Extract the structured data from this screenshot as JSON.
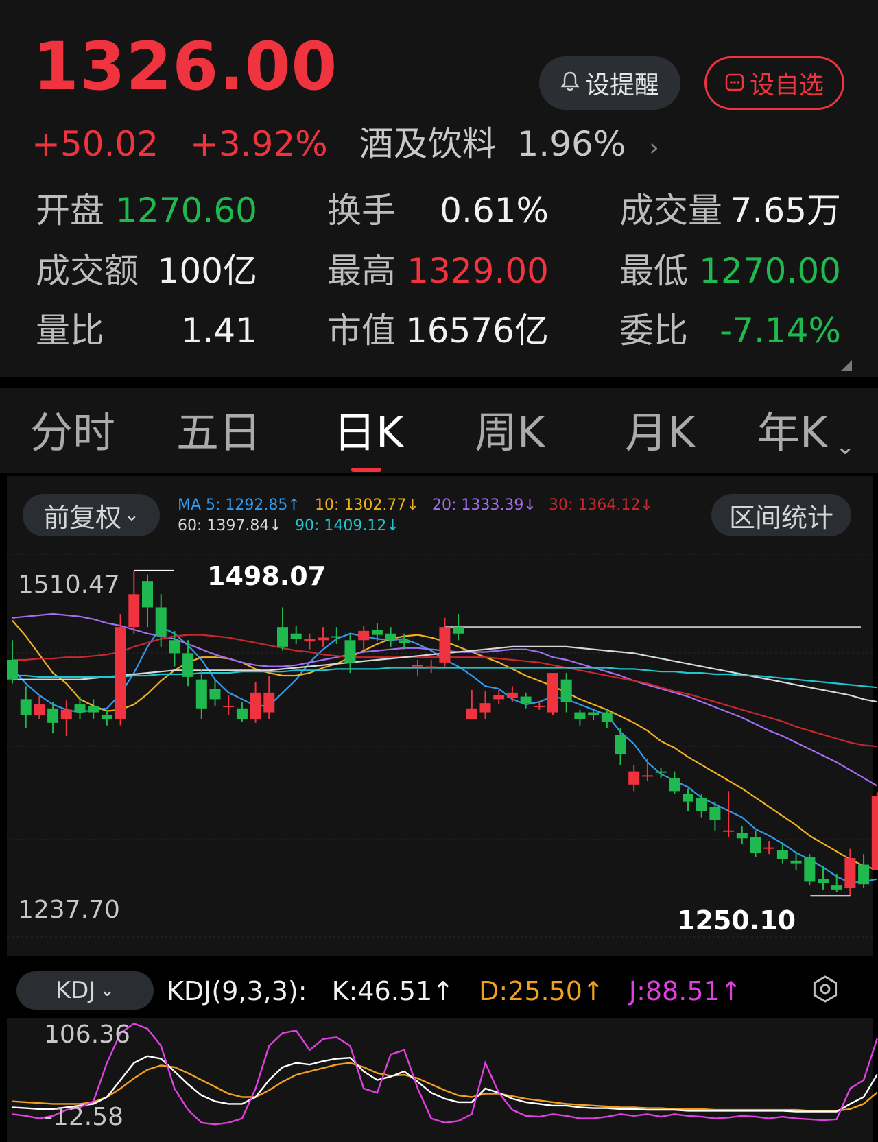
{
  "quote": {
    "price": "1326.00",
    "change": "+50.02",
    "change_pct": "+3.92%",
    "sector_name": "酒及饮料",
    "sector_change": "1.96%",
    "sector_arrow": "›",
    "alert_label": "设提醒",
    "watch_label": "设自选",
    "colors": {
      "up": "#f0343f",
      "down": "#1fb94f"
    }
  },
  "stats": [
    {
      "label": "开盘",
      "value": "1270.60",
      "color": "green"
    },
    {
      "label": "换手",
      "value": "0.61%",
      "color": "white"
    },
    {
      "label": "成交量",
      "value": "7.65万",
      "color": "white"
    },
    {
      "label": "成交额",
      "value": "100亿",
      "color": "white"
    },
    {
      "label": "最高",
      "value": "1329.00",
      "color": "red"
    },
    {
      "label": "最低",
      "value": "1270.00",
      "color": "green"
    },
    {
      "label": "量比",
      "value": "1.41",
      "color": "white"
    },
    {
      "label": "市值",
      "value": "16576亿",
      "color": "white"
    },
    {
      "label": "委比",
      "value": "-7.14%",
      "color": "green"
    }
  ],
  "tabs": [
    {
      "label": "分时",
      "active": false
    },
    {
      "label": "五日",
      "active": false
    },
    {
      "label": "日K",
      "active": true
    },
    {
      "label": "周K",
      "active": false
    },
    {
      "label": "月K",
      "active": false
    },
    {
      "label": "年K",
      "active": false
    }
  ],
  "tab_more": "⌄",
  "chart_controls": {
    "adjust_label": "前复权",
    "range_label": "区间统计",
    "dropdown": "⌄"
  },
  "ma_legend": [
    {
      "text": "MA 5: 1292.85↑",
      "color": "#2f9bf0"
    },
    {
      "text": "10: 1302.77↓",
      "color": "#f2b01e"
    },
    {
      "text": "20: 1333.39↓",
      "color": "#a46ef2"
    },
    {
      "text": "30: 1364.12↓",
      "color": "#c9262d"
    },
    {
      "text": "60: 1397.84↓",
      "color": "#d9d9d9"
    },
    {
      "text": "90: 1409.12↓",
      "color": "#1ec6cf"
    }
  ],
  "chart_data": {
    "type": "candlestick",
    "ymax_label": "1510.47",
    "ymin_label": "1237.70",
    "ylim": [
      1237.7,
      1510.47
    ],
    "high_mark": "1498.07",
    "low_mark": "1250.10",
    "ref_line": 1455,
    "candles": [
      [
        1430,
        1415,
        1445,
        1412
      ],
      [
        1400,
        1388,
        1410,
        1378
      ],
      [
        1388,
        1396,
        1403,
        1385
      ],
      [
        1393,
        1382,
        1398,
        1374
      ],
      [
        1385,
        1392,
        1399,
        1372
      ],
      [
        1396,
        1390,
        1402,
        1385
      ],
      [
        1395,
        1390,
        1400,
        1385
      ],
      [
        1388,
        1385,
        1392,
        1380
      ],
      [
        1385,
        1455,
        1465,
        1380
      ],
      [
        1455,
        1480,
        1498,
        1450
      ],
      [
        1490,
        1470,
        1495,
        1455
      ],
      [
        1470,
        1448,
        1480,
        1440
      ],
      [
        1445,
        1435,
        1452,
        1425
      ],
      [
        1435,
        1417,
        1445,
        1410
      ],
      [
        1415,
        1393,
        1423,
        1385
      ],
      [
        1408,
        1400,
        1415,
        1395
      ],
      [
        1395,
        1395,
        1403,
        1388
      ],
      [
        1393,
        1385,
        1398,
        1383
      ],
      [
        1385,
        1405,
        1413,
        1382
      ],
      [
        1390,
        1405,
        1418,
        1385
      ],
      [
        1455,
        1440,
        1470,
        1437
      ],
      [
        1450,
        1446,
        1456,
        1442
      ],
      [
        1444,
        1446,
        1450,
        1438
      ],
      [
        1445,
        1447,
        1455,
        1440
      ],
      [
        1448,
        1447,
        1455,
        1442
      ],
      [
        1445,
        1428,
        1450,
        1420
      ],
      [
        1445,
        1452,
        1456,
        1438
      ],
      [
        1453,
        1449,
        1458,
        1444
      ],
      [
        1450,
        1445,
        1455,
        1440
      ],
      [
        1445,
        1443,
        1450,
        1438
      ],
      [
        1425,
        1426,
        1430,
        1418
      ],
      [
        1425,
        1425,
        1430,
        1420
      ],
      [
        1428,
        1455,
        1462,
        1425
      ],
      [
        1455,
        1450,
        1465,
        1445
      ],
      [
        1385,
        1393,
        1407,
        1385
      ],
      [
        1390,
        1397,
        1406,
        1385
      ],
      [
        1400,
        1403,
        1407,
        1396
      ],
      [
        1401,
        1405,
        1410,
        1398
      ],
      [
        1402,
        1397,
        1405,
        1393
      ],
      [
        1395,
        1395,
        1398,
        1392
      ],
      [
        1390,
        1420,
        1420,
        1388
      ],
      [
        1415,
        1398,
        1420,
        1390
      ],
      [
        1390,
        1385,
        1392,
        1380
      ],
      [
        1390,
        1388,
        1393,
        1384
      ],
      [
        1390,
        1383,
        1392,
        1378
      ],
      [
        1373,
        1358,
        1378,
        1350
      ],
      [
        1335,
        1345,
        1350,
        1330
      ],
      [
        1342,
        1342,
        1355,
        1338
      ],
      [
        1345,
        1344,
        1348,
        1340
      ],
      [
        1340,
        1330,
        1345,
        1328
      ],
      [
        1328,
        1322,
        1332,
        1315
      ],
      [
        1325,
        1315,
        1328,
        1310
      ],
      [
        1318,
        1308,
        1322,
        1300
      ],
      [
        1300,
        1300,
        1330,
        1295
      ],
      [
        1298,
        1294,
        1303,
        1290
      ],
      [
        1295,
        1283,
        1300,
        1280
      ],
      [
        1287,
        1287,
        1292,
        1282
      ],
      [
        1285,
        1278,
        1290,
        1275
      ],
      [
        1277,
        1275,
        1283,
        1270
      ],
      [
        1280,
        1261,
        1282,
        1258
      ],
      [
        1263,
        1260,
        1273,
        1255
      ],
      [
        1258,
        1255,
        1267,
        1253
      ],
      [
        1256,
        1279,
        1286,
        1250
      ],
      [
        1274,
        1259,
        1282,
        1256
      ],
      [
        1270,
        1326,
        1329,
        1270
      ]
    ],
    "ma": {
      "ma5": [
        1423,
        1412,
        1403,
        1396,
        1392,
        1390,
        1392,
        1393,
        1404,
        1420,
        1440,
        1455,
        1450,
        1441,
        1430,
        1415,
        1405,
        1400,
        1395,
        1395,
        1405,
        1415,
        1428,
        1438,
        1446,
        1450,
        1448,
        1446,
        1445,
        1446,
        1442,
        1437,
        1430,
        1425,
        1418,
        1410,
        1408,
        1400,
        1396,
        1398,
        1402,
        1400,
        1396,
        1392,
        1388,
        1375,
        1366,
        1352,
        1343,
        1338,
        1333,
        1325,
        1320,
        1315,
        1310,
        1301,
        1296,
        1290,
        1283,
        1278,
        1272,
        1265,
        1260,
        1261,
        1263
      ],
      "ma10": [
        1460,
        1448,
        1434,
        1420,
        1412,
        1400,
        1395,
        1391,
        1392,
        1396,
        1404,
        1414,
        1422,
        1428,
        1432,
        1432,
        1431,
        1428,
        1423,
        1420,
        1418,
        1418,
        1420,
        1424,
        1427,
        1432,
        1437,
        1442,
        1446,
        1448,
        1449,
        1447,
        1444,
        1440,
        1436,
        1432,
        1428,
        1423,
        1418,
        1414,
        1410,
        1405,
        1400,
        1396,
        1392,
        1387,
        1382,
        1376,
        1368,
        1363,
        1356,
        1350,
        1344,
        1338,
        1332,
        1325,
        1318,
        1311,
        1304,
        1296,
        1290,
        1284,
        1278,
        1273,
        1270
      ],
      "ma20": [
        1462,
        1463,
        1464,
        1465,
        1464,
        1463,
        1461,
        1458,
        1456,
        1453,
        1450,
        1448,
        1446,
        1442,
        1438,
        1434,
        1431,
        1428,
        1426,
        1425,
        1425,
        1426,
        1428,
        1430,
        1432,
        1434,
        1436,
        1437,
        1438,
        1439,
        1439,
        1438,
        1437,
        1436,
        1436,
        1436,
        1437,
        1438,
        1438,
        1436,
        1432,
        1430,
        1427,
        1424,
        1421,
        1418,
        1414,
        1411,
        1408,
        1405,
        1402,
        1398,
        1394,
        1390,
        1386,
        1381,
        1376,
        1372,
        1367,
        1362,
        1357,
        1352,
        1346,
        1340,
        1334
      ],
      "ma30": [
        1430,
        1430,
        1431,
        1431,
        1432,
        1432,
        1433,
        1434,
        1436,
        1440,
        1443,
        1446,
        1448,
        1449,
        1449,
        1448,
        1447,
        1445,
        1443,
        1441,
        1439,
        1437,
        1436,
        1434,
        1433,
        1432,
        1432,
        1432,
        1432,
        1432,
        1432,
        1432,
        1432,
        1432,
        1432,
        1432,
        1431,
        1430,
        1429,
        1428,
        1426,
        1424,
        1422,
        1420,
        1418,
        1416,
        1414,
        1412,
        1409,
        1406,
        1404,
        1401,
        1398,
        1395,
        1392,
        1389,
        1386,
        1383,
        1379,
        1376,
        1373,
        1370,
        1367,
        1365,
        1364
      ],
      "ma60": [
        1415,
        1415,
        1415,
        1415,
        1415,
        1415,
        1416,
        1417,
        1418,
        1419,
        1420,
        1421,
        1422,
        1422,
        1422,
        1422,
        1422,
        1422,
        1422,
        1422,
        1423,
        1424,
        1425,
        1426,
        1427,
        1428,
        1429,
        1430,
        1431,
        1432,
        1433,
        1434,
        1435,
        1436,
        1437,
        1438,
        1439,
        1440,
        1440,
        1440,
        1440,
        1440,
        1439,
        1438,
        1437,
        1436,
        1435,
        1433,
        1431,
        1429,
        1427,
        1425,
        1423,
        1421,
        1419,
        1417,
        1415,
        1413,
        1411,
        1409,
        1407,
        1405,
        1403,
        1400,
        1398
      ],
      "ma90": [
        1418,
        1418,
        1417,
        1417,
        1417,
        1417,
        1417,
        1417,
        1417,
        1418,
        1418,
        1419,
        1419,
        1419,
        1420,
        1420,
        1420,
        1421,
        1421,
        1421,
        1421,
        1422,
        1422,
        1422,
        1423,
        1423,
        1423,
        1423,
        1424,
        1424,
        1424,
        1424,
        1424,
        1424,
        1424,
        1424,
        1424,
        1424,
        1424,
        1424,
        1424,
        1424,
        1424,
        1424,
        1424,
        1423,
        1423,
        1422,
        1421,
        1421,
        1420,
        1420,
        1419,
        1419,
        1418,
        1418,
        1417,
        1416,
        1415,
        1414,
        1413,
        1412,
        1411,
        1410,
        1409
      ]
    }
  },
  "kdj": {
    "button_label": "KDJ",
    "dropdown": "⌄",
    "params": "KDJ(9,3,3):",
    "k_text": "K:46.51↑",
    "d_text": "D:25.50↑",
    "j_text": "J:88.51↑",
    "ymax_label": "106.36",
    "ymin_label": "-12.58",
    "ylim": [
      -12.58,
      106.36
    ],
    "colors": {
      "k": "#ffffff",
      "d": "#f2a01e",
      "j": "#e040e0"
    },
    "k": [
      8,
      7,
      6,
      6,
      8,
      10,
      12,
      20,
      40,
      60,
      68,
      65,
      50,
      35,
      22,
      15,
      12,
      12,
      20,
      40,
      55,
      60,
      58,
      62,
      65,
      66,
      50,
      40,
      44,
      50,
      38,
      25,
      18,
      14,
      14,
      30,
      25,
      18,
      14,
      12,
      10,
      10,
      8,
      7,
      7,
      6,
      6,
      5,
      5,
      5,
      4,
      4,
      4,
      4,
      4,
      4,
      4,
      4,
      3,
      3,
      3,
      3,
      12,
      20,
      46.51
    ],
    "d": [
      15,
      14,
      13,
      12,
      12,
      12,
      14,
      20,
      30,
      42,
      52,
      57,
      55,
      48,
      40,
      32,
      24,
      20,
      20,
      28,
      38,
      46,
      50,
      54,
      58,
      60,
      55,
      48,
      45,
      46,
      42,
      35,
      28,
      22,
      20,
      24,
      24,
      21,
      18,
      16,
      14,
      12,
      11,
      10,
      9,
      8,
      8,
      7,
      7,
      6,
      6,
      6,
      5,
      5,
      5,
      5,
      5,
      5,
      5,
      4,
      4,
      4,
      6,
      12,
      25.5
    ],
    "j": [
      0,
      -2,
      -5,
      -2,
      5,
      8,
      15,
      60,
      95,
      106,
      100,
      80,
      30,
      5,
      -10,
      -12,
      -10,
      -5,
      30,
      80,
      95,
      98,
      75,
      88,
      90,
      80,
      30,
      25,
      70,
      75,
      30,
      -5,
      -10,
      -8,
      0,
      60,
      25,
      5,
      -2,
      -3,
      0,
      -2,
      -5,
      -5,
      -3,
      0,
      -2,
      0,
      -3,
      0,
      -2,
      -3,
      -5,
      -4,
      -2,
      -3,
      -5,
      -3,
      -5,
      -6,
      -7,
      -6,
      30,
      40,
      88.51
    ]
  }
}
